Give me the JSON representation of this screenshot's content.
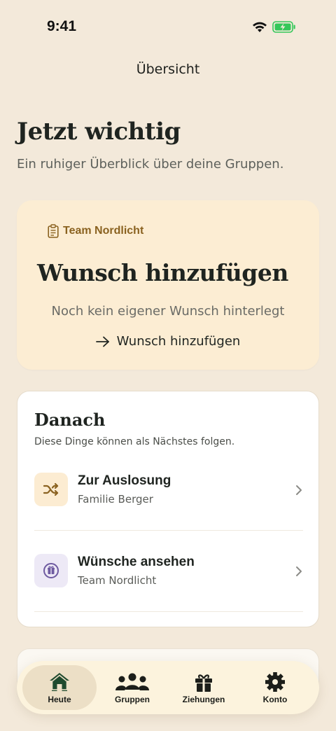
{
  "status_bar": {
    "time": "9:41"
  },
  "nav": {
    "title": "Übersicht"
  },
  "hero": {
    "title": "Jetzt wichtig",
    "subtitle": "Ein ruhiger Überblick über deine Gruppen."
  },
  "focus_card": {
    "group": "Team Nordlicht",
    "title": "Wunsch hinzufügen",
    "subtitle": "Noch kein eigener Wunsch hinterlegt",
    "action_label": "Wunsch hinzufügen"
  },
  "next_card": {
    "title": "Danach",
    "subtitle": "Diese Dinge können als Nächstes folgen.",
    "items": [
      {
        "title": "Zur Auslosung",
        "subtitle": "Familie Berger",
        "icon": "shuffle-icon"
      },
      {
        "title": "Wünsche ansehen",
        "subtitle": "Team Nordlicht",
        "icon": "gift-icon"
      }
    ]
  },
  "tab_bar": {
    "tabs": [
      {
        "label": "Heute",
        "icon": "home-icon",
        "active": true
      },
      {
        "label": "Gruppen",
        "icon": "people-icon",
        "active": false
      },
      {
        "label": "Ziehungen",
        "icon": "gift-icon",
        "active": false
      },
      {
        "label": "Konto",
        "icon": "gear-icon",
        "active": false
      }
    ]
  },
  "colors": {
    "background": "#f3e9da",
    "accent_gold": "#8a6220",
    "focus_card": "#fcedd3",
    "tab_active": "#ecdfc6",
    "icon_green": "#1f4a2e",
    "battery_green": "#34c759"
  }
}
